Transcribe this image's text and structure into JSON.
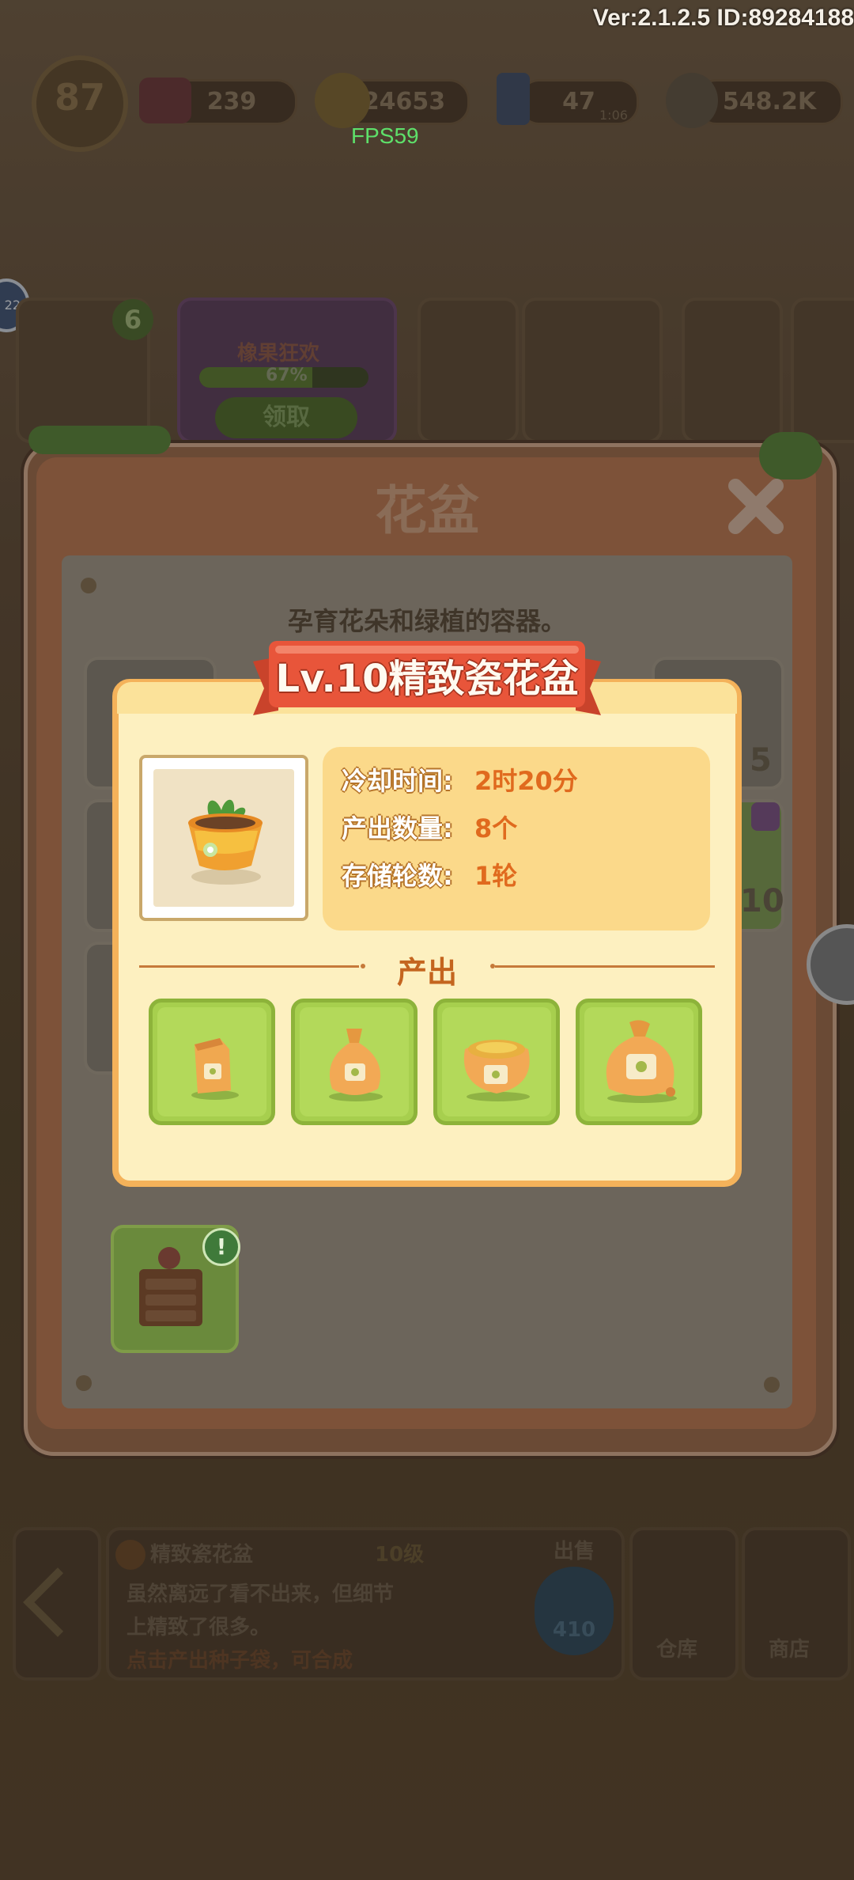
{
  "hud": {
    "version_text": "Ver:2.1.2.5 ID:89284188",
    "fps_text": "FPS59",
    "level": "87",
    "gems": "239",
    "coins": "24653",
    "energy": "47",
    "energy_timer": "1:06",
    "seeds": "548.2K"
  },
  "event_panel": {
    "title": "橡果狂欢",
    "progress_text": "67%",
    "progress_fraction": 0.67,
    "claim_label": "领取",
    "badge_count": "6",
    "side_badge": "22"
  },
  "dialog": {
    "title": "花盆",
    "description": "孕育花朵和绿植的容器。",
    "grid_counts": [
      "5",
      "10"
    ]
  },
  "popup": {
    "banner": "Lv.10精致瓷花盆",
    "stats": [
      {
        "label": "冷却时间:",
        "value": "2时20分"
      },
      {
        "label": "产出数量:",
        "value": "8个"
      },
      {
        "label": "存储轮数:",
        "value": "1轮"
      }
    ],
    "output_header": "产出",
    "outputs": [
      "small-seed-bag-icon",
      "seed-pouch-icon",
      "open-seed-sack-icon",
      "large-seed-sack-icon"
    ]
  },
  "bottom_bar": {
    "item_name": "精致瓷花盆",
    "item_level": "10级",
    "item_desc_1": "虽然离远了看不出来，但细节",
    "item_desc_2": "上精致了很多。",
    "item_hint": "点击产出种子袋，可合成",
    "sell_label": "出售",
    "sell_price": "410",
    "warehouse_label": "仓库",
    "shop_label": "商店"
  },
  "colors": {
    "banner_red": "#e8553a",
    "card_border": "#f4b25a",
    "card_fill": "#fdf0c0",
    "slot_green": "#a7cf4e",
    "value_orange": "#e06a1e"
  }
}
